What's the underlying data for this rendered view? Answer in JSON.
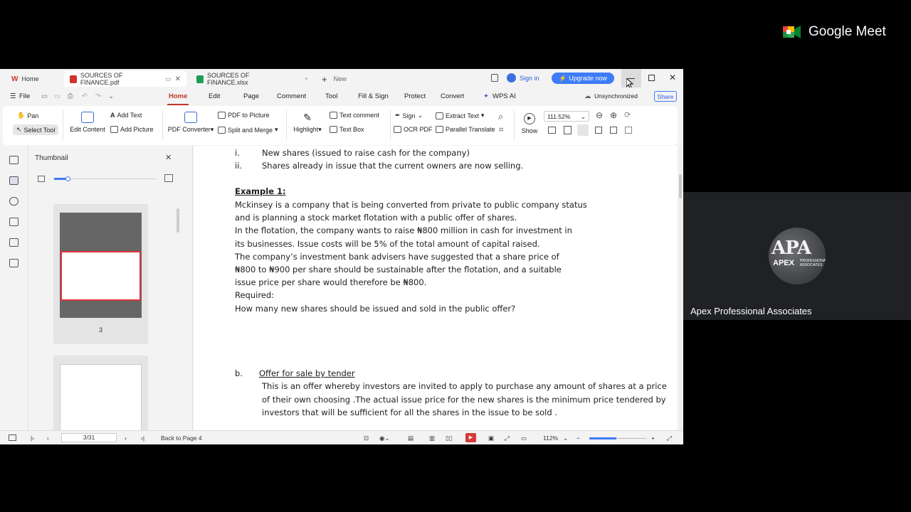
{
  "meet": {
    "brand": "Google Meet",
    "participant_name": "Apex Professional Associates",
    "avatar_text": "APA",
    "avatar_sub": "APEX",
    "avatar_small": "PROFESSIONAL ASSOCIATES"
  },
  "tabs": [
    {
      "label": "Home",
      "active": false
    },
    {
      "label": "SOURCES OF FINANCE.pdf",
      "active": true
    },
    {
      "label": "SOURCES OF FINANCE.xlsx",
      "active": false
    },
    {
      "label": "New",
      "active": false
    }
  ],
  "header": {
    "sign_in": "Sign in",
    "upgrade": "Upgrade now"
  },
  "menu": {
    "file": "File",
    "items": [
      "Home",
      "Edit",
      "Page",
      "Comment",
      "Tool",
      "Fill & Sign",
      "Protect",
      "Convert",
      "WPS AI"
    ],
    "unsync": "Unsynchronized",
    "share": "Share"
  },
  "ribbon": {
    "pan": "Pan",
    "select_tool": "Select Tool",
    "edit_content": "Edit Content",
    "add_text": "Add Text",
    "add_picture": "Add Picture",
    "pdf_converter": "PDF Converter",
    "pdf_to_picture": "PDF to Picture",
    "split_merge": "Split and Merge",
    "highlight": "Highlight",
    "text_comment": "Text comment",
    "text_box": "Text Box",
    "sign": "Sign",
    "ocr_pdf": "OCR PDF",
    "extract_text": "Extract Text",
    "parallel_translate": "Parallel Translate",
    "show": "Show",
    "zoom": "111.52%"
  },
  "thumbnail": {
    "title": "Thumbnail",
    "page_label": "3"
  },
  "doc": {
    "line_i_num": "i.",
    "line_i": "New shares (issued to raise cash for the company)",
    "line_ii_num": "ii.",
    "line_ii": "Shares already in issue that the current owners are now selling.",
    "example_title": "Example 1:",
    "p1": "Mckinsey is a company that is being converted from private to public company status",
    "p2": "and is planning a stock market flotation with a public offer of shares.",
    "p3": "In the flotation, the company wants to raise ₦800 million in cash for investment in",
    "p4": "its businesses. Issue costs will be 5% of the total amount of capital raised.",
    "p5": "The company’s investment bank advisers have suggested that a share price of",
    "p6": "₦800 to ₦900 per share should be sustainable after the flotation, and a suitable",
    "p7": "issue price per share would therefore be ₦800.",
    "required": "Required:",
    "question": "How many new shares should be issued and sold in the public offer?",
    "b_num": "b.",
    "b_title": "Offer for sale by tender",
    "b1": "This is an offer whereby investors are invited to apply to purchase any amount of shares at a price",
    "b2": "of their own choosing .The actual issue price for the new shares is the minimum price tendered by",
    "b3": "investors that will be sufficient for all the shares in the issue to be sold ."
  },
  "status": {
    "page": "3/31",
    "back": "Back to Page 4",
    "zoom": "112%"
  }
}
